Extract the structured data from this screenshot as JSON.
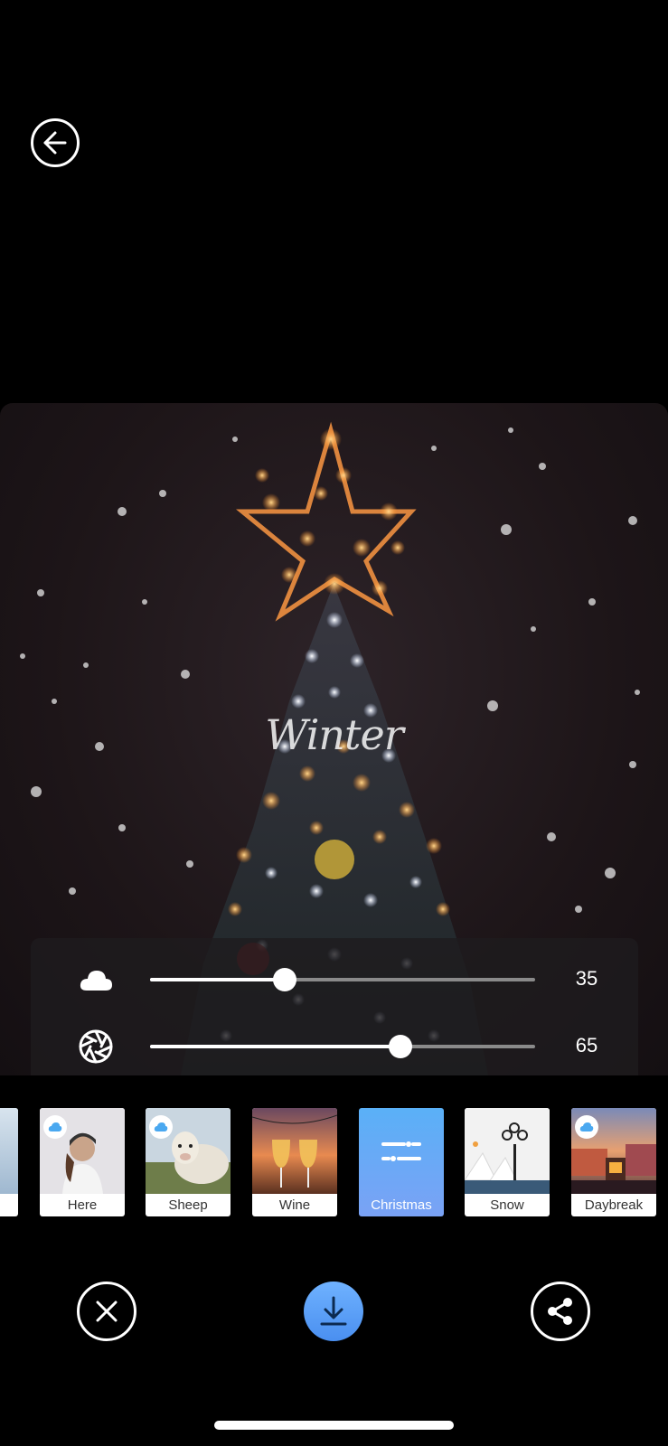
{
  "header": {
    "back_icon": "arrow-left-icon"
  },
  "photo": {
    "overlay_text": "Winter",
    "description_icon": "christmas-tree-photo"
  },
  "sliders": [
    {
      "icon": "cloud-icon",
      "value": 35,
      "value_label": "35"
    },
    {
      "icon": "aperture-icon",
      "value": 65,
      "value_label": "65"
    }
  ],
  "filters": {
    "selected": "Christmas",
    "items": [
      {
        "label": "",
        "cloud": false
      },
      {
        "label": "Here",
        "cloud": true
      },
      {
        "label": "Sheep",
        "cloud": true
      },
      {
        "label": "Wine",
        "cloud": false
      },
      {
        "label": "Christmas",
        "cloud": false,
        "selected": true,
        "icon": "sliders-icon"
      },
      {
        "label": "Snow",
        "cloud": false
      },
      {
        "label": "Daybreak",
        "cloud": true
      }
    ]
  },
  "actions": {
    "cancel_icon": "close-icon",
    "download_icon": "download-icon",
    "share_icon": "share-icon"
  },
  "colors": {
    "accent": "#5aa6f7",
    "background": "#000000"
  }
}
